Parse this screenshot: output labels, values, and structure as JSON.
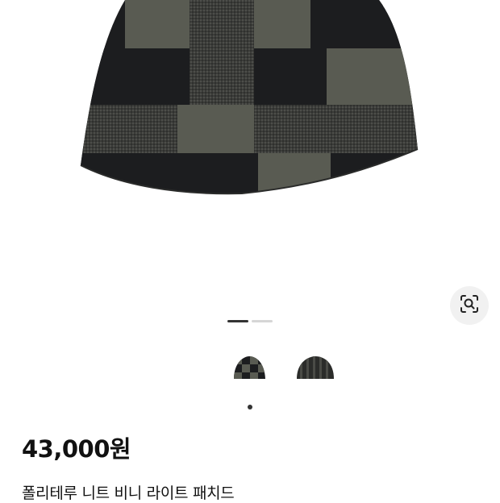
{
  "product": {
    "price": "43,000원",
    "title": "폴리테루 니트 비니 라이트 패치드"
  },
  "gallery": {
    "current_image": 1,
    "image_count": 2,
    "thumbnails": [
      "front-checker-beanie",
      "back-checker-beanie"
    ]
  },
  "icons": {
    "lens": "visual-search-icon"
  },
  "colors": {
    "knit_dark": "#1b1c1e",
    "knit_olive": "#595b52",
    "knit_mid": "#3a3b39",
    "pager_active": "#333333",
    "pager_inactive": "#d6d6d6"
  }
}
